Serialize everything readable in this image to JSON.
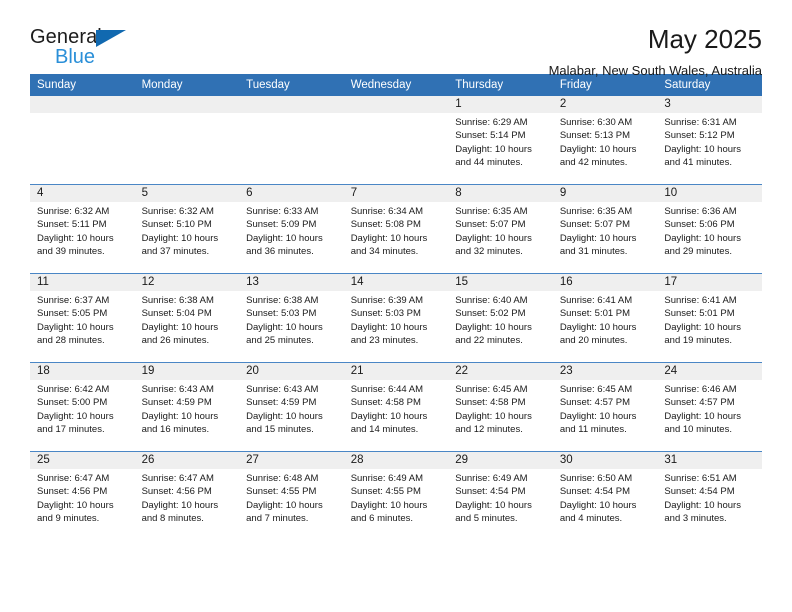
{
  "logo": {
    "word_top": "General",
    "word_bottom": "Blue",
    "triangle_color": "#1169b0",
    "blue_text_color": "#2a8fd8"
  },
  "header": {
    "month_title": "May 2025",
    "location": "Malabar, New South Wales, Australia"
  },
  "theme": {
    "header_blue": "#3071b4",
    "daynum_band": "#efefef",
    "week_separator": "#4a86c5"
  },
  "calendar": {
    "weekday_headers": [
      "Sunday",
      "Monday",
      "Tuesday",
      "Wednesday",
      "Thursday",
      "Friday",
      "Saturday"
    ],
    "weeks": [
      [
        {
          "day": "",
          "lines": []
        },
        {
          "day": "",
          "lines": []
        },
        {
          "day": "",
          "lines": []
        },
        {
          "day": "",
          "lines": []
        },
        {
          "day": "1",
          "lines": [
            "Sunrise: 6:29 AM",
            "Sunset: 5:14 PM",
            "Daylight: 10 hours and 44 minutes."
          ]
        },
        {
          "day": "2",
          "lines": [
            "Sunrise: 6:30 AM",
            "Sunset: 5:13 PM",
            "Daylight: 10 hours and 42 minutes."
          ]
        },
        {
          "day": "3",
          "lines": [
            "Sunrise: 6:31 AM",
            "Sunset: 5:12 PM",
            "Daylight: 10 hours and 41 minutes."
          ]
        }
      ],
      [
        {
          "day": "4",
          "lines": [
            "Sunrise: 6:32 AM",
            "Sunset: 5:11 PM",
            "Daylight: 10 hours and 39 minutes."
          ]
        },
        {
          "day": "5",
          "lines": [
            "Sunrise: 6:32 AM",
            "Sunset: 5:10 PM",
            "Daylight: 10 hours and 37 minutes."
          ]
        },
        {
          "day": "6",
          "lines": [
            "Sunrise: 6:33 AM",
            "Sunset: 5:09 PM",
            "Daylight: 10 hours and 36 minutes."
          ]
        },
        {
          "day": "7",
          "lines": [
            "Sunrise: 6:34 AM",
            "Sunset: 5:08 PM",
            "Daylight: 10 hours and 34 minutes."
          ]
        },
        {
          "day": "8",
          "lines": [
            "Sunrise: 6:35 AM",
            "Sunset: 5:07 PM",
            "Daylight: 10 hours and 32 minutes."
          ]
        },
        {
          "day": "9",
          "lines": [
            "Sunrise: 6:35 AM",
            "Sunset: 5:07 PM",
            "Daylight: 10 hours and 31 minutes."
          ]
        },
        {
          "day": "10",
          "lines": [
            "Sunrise: 6:36 AM",
            "Sunset: 5:06 PM",
            "Daylight: 10 hours and 29 minutes."
          ]
        }
      ],
      [
        {
          "day": "11",
          "lines": [
            "Sunrise: 6:37 AM",
            "Sunset: 5:05 PM",
            "Daylight: 10 hours and 28 minutes."
          ]
        },
        {
          "day": "12",
          "lines": [
            "Sunrise: 6:38 AM",
            "Sunset: 5:04 PM",
            "Daylight: 10 hours and 26 minutes."
          ]
        },
        {
          "day": "13",
          "lines": [
            "Sunrise: 6:38 AM",
            "Sunset: 5:03 PM",
            "Daylight: 10 hours and 25 minutes."
          ]
        },
        {
          "day": "14",
          "lines": [
            "Sunrise: 6:39 AM",
            "Sunset: 5:03 PM",
            "Daylight: 10 hours and 23 minutes."
          ]
        },
        {
          "day": "15",
          "lines": [
            "Sunrise: 6:40 AM",
            "Sunset: 5:02 PM",
            "Daylight: 10 hours and 22 minutes."
          ]
        },
        {
          "day": "16",
          "lines": [
            "Sunrise: 6:41 AM",
            "Sunset: 5:01 PM",
            "Daylight: 10 hours and 20 minutes."
          ]
        },
        {
          "day": "17",
          "lines": [
            "Sunrise: 6:41 AM",
            "Sunset: 5:01 PM",
            "Daylight: 10 hours and 19 minutes."
          ]
        }
      ],
      [
        {
          "day": "18",
          "lines": [
            "Sunrise: 6:42 AM",
            "Sunset: 5:00 PM",
            "Daylight: 10 hours and 17 minutes."
          ]
        },
        {
          "day": "19",
          "lines": [
            "Sunrise: 6:43 AM",
            "Sunset: 4:59 PM",
            "Daylight: 10 hours and 16 minutes."
          ]
        },
        {
          "day": "20",
          "lines": [
            "Sunrise: 6:43 AM",
            "Sunset: 4:59 PM",
            "Daylight: 10 hours and 15 minutes."
          ]
        },
        {
          "day": "21",
          "lines": [
            "Sunrise: 6:44 AM",
            "Sunset: 4:58 PM",
            "Daylight: 10 hours and 14 minutes."
          ]
        },
        {
          "day": "22",
          "lines": [
            "Sunrise: 6:45 AM",
            "Sunset: 4:58 PM",
            "Daylight: 10 hours and 12 minutes."
          ]
        },
        {
          "day": "23",
          "lines": [
            "Sunrise: 6:45 AM",
            "Sunset: 4:57 PM",
            "Daylight: 10 hours and 11 minutes."
          ]
        },
        {
          "day": "24",
          "lines": [
            "Sunrise: 6:46 AM",
            "Sunset: 4:57 PM",
            "Daylight: 10 hours and 10 minutes."
          ]
        }
      ],
      [
        {
          "day": "25",
          "lines": [
            "Sunrise: 6:47 AM",
            "Sunset: 4:56 PM",
            "Daylight: 10 hours and 9 minutes."
          ]
        },
        {
          "day": "26",
          "lines": [
            "Sunrise: 6:47 AM",
            "Sunset: 4:56 PM",
            "Daylight: 10 hours and 8 minutes."
          ]
        },
        {
          "day": "27",
          "lines": [
            "Sunrise: 6:48 AM",
            "Sunset: 4:55 PM",
            "Daylight: 10 hours and 7 minutes."
          ]
        },
        {
          "day": "28",
          "lines": [
            "Sunrise: 6:49 AM",
            "Sunset: 4:55 PM",
            "Daylight: 10 hours and 6 minutes."
          ]
        },
        {
          "day": "29",
          "lines": [
            "Sunrise: 6:49 AM",
            "Sunset: 4:54 PM",
            "Daylight: 10 hours and 5 minutes."
          ]
        },
        {
          "day": "30",
          "lines": [
            "Sunrise: 6:50 AM",
            "Sunset: 4:54 PM",
            "Daylight: 10 hours and 4 minutes."
          ]
        },
        {
          "day": "31",
          "lines": [
            "Sunrise: 6:51 AM",
            "Sunset: 4:54 PM",
            "Daylight: 10 hours and 3 minutes."
          ]
        }
      ]
    ]
  }
}
